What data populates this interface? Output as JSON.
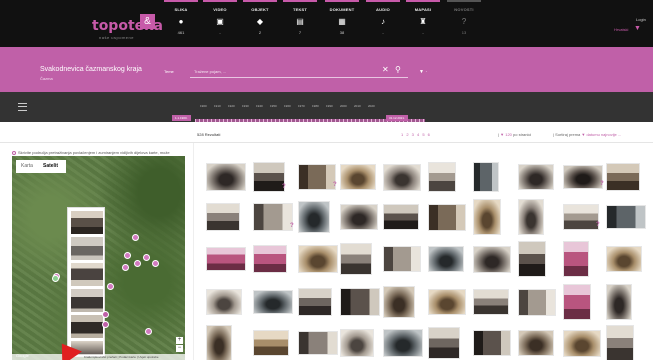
{
  "app": {
    "logo": "topoteka",
    "logo_badge": "&",
    "tagline": "naše uspomene"
  },
  "categories": [
    {
      "label": "SLIKA",
      "icon": "●",
      "icon_name": "camera-icon",
      "count": "461"
    },
    {
      "label": "VIDEO",
      "icon": "▣",
      "icon_name": "film-icon",
      "count": "-"
    },
    {
      "label": "OBJEKT",
      "icon": "◆",
      "icon_name": "object-icon",
      "count": "2"
    },
    {
      "label": "TEKST",
      "icon": "▤",
      "icon_name": "text-icon",
      "count": "7"
    },
    {
      "label": "DOKUMENT",
      "icon": "▦",
      "icon_name": "document-icon",
      "count": "38"
    },
    {
      "label": "AUDIO",
      "icon": "♪",
      "icon_name": "audio-icon",
      "count": "-"
    },
    {
      "label": "MAPASI",
      "icon": "♜",
      "icon_name": "map-icon",
      "count": "-"
    },
    {
      "label": "NOVOSTI",
      "icon": "?",
      "icon_name": "question-icon",
      "count": "13"
    }
  ],
  "top_right": {
    "label": "Login",
    "lang": "Hrvatski",
    "flag": "▼"
  },
  "header": {
    "title": "Svakodnevica čazmanskog kraja",
    "subtitle": "Čazma",
    "search_label": "Teme",
    "search_placeholder": "Tražene pojam, ...",
    "clear_icon": "✕",
    "search_icon": "⚲",
    "more": "▼  ·"
  },
  "timeline": {
    "years": [
      "1900",
      "1910",
      "1920",
      "1930",
      "1940",
      "1950",
      "1960",
      "1970",
      "1980",
      "1990",
      "2000",
      "2010",
      "2020"
    ],
    "start_label": "1.1.1900.",
    "end_label": "31.12.2021."
  },
  "results": {
    "count_text": "528 Rezultati",
    "pages": "1 2 3 4 5 6",
    "perpage_sep": "|  ",
    "perpage_value": "▼ 120",
    "perpage_suffix": " po stranici",
    "sort_label": "|   Sortiraj prema ",
    "sort_value": "▼ datumu najnovije ..."
  },
  "map": {
    "toggle_label": "Skrivite područja pretraživanja povlačenjem i zumiranjem vidljivih dijelova karte, može",
    "tab_map": "Karta",
    "tab_satellite": "Satelit",
    "google": "Google",
    "footer": "Kratki tipkovnički prečaci | Podaci karte | Uvjeti upotrebe",
    "zoom_in": "+",
    "zoom_out": "−"
  },
  "grid": {
    "question_mark": "?"
  }
}
